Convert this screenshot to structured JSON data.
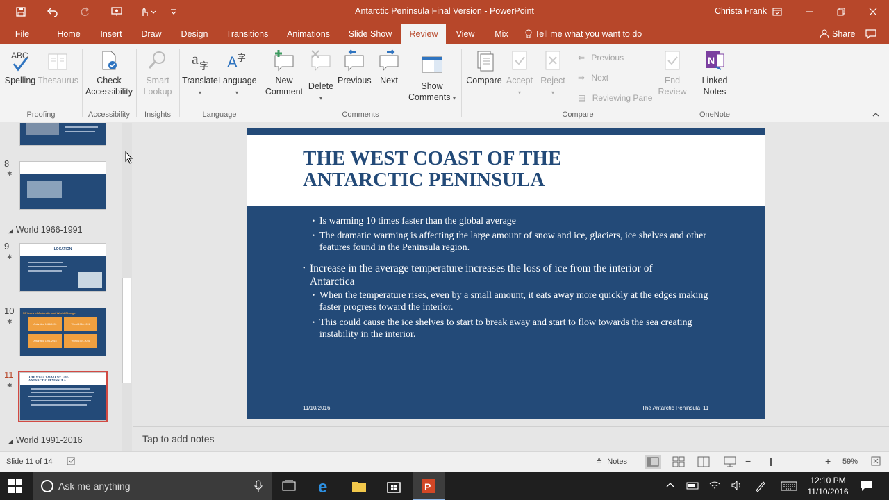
{
  "window": {
    "title": "Antarctic Peninsula Final Version  -  PowerPoint",
    "user": "Christa Frank"
  },
  "tabs": [
    "File",
    "Home",
    "Insert",
    "Draw",
    "Design",
    "Transitions",
    "Animations",
    "Slide Show",
    "Review",
    "View",
    "Mix"
  ],
  "active_tab": "Review",
  "tell_me": "Tell me what you want to do",
  "share": "Share",
  "ribbon": {
    "proofing": {
      "label": "Proofing",
      "spelling": "Spelling",
      "spelling_abc": "ABC",
      "thesaurus": "Thesaurus"
    },
    "accessibility": {
      "label": "Accessibility",
      "check": "Check",
      "check2": "Accessibility"
    },
    "insights": {
      "label": "Insights",
      "smart": "Smart",
      "smart2": "Lookup"
    },
    "language": {
      "label": "Language",
      "translate": "Translate",
      "language": "Language"
    },
    "comments": {
      "label": "Comments",
      "new": "New",
      "new2": "Comment",
      "delete": "Delete",
      "previous": "Previous",
      "next": "Next",
      "show": "Show",
      "show2": "Comments"
    },
    "compare": {
      "label": "Compare",
      "compare": "Compare",
      "accept": "Accept",
      "reject": "Reject",
      "previous": "Previous",
      "next": "Next",
      "reviewing_pane": "Reviewing Pane",
      "end": "End",
      "end2": "Review"
    },
    "onenote": {
      "label": "OneNote",
      "linked": "Linked",
      "linked2": "Notes"
    }
  },
  "thumbnails": {
    "sections": [
      "World 1966-1991",
      "World 1991-2016"
    ],
    "numbers": [
      "8",
      "9",
      "10",
      "11"
    ],
    "slide9_title": "LOCATION",
    "slide10_title": "50 Years of Antarctic and World Change",
    "slide10_cells": [
      "Antarctica 1966-1991",
      "World 1966-1991",
      "Antarctica 1991-2016",
      "World 1991-2016"
    ],
    "slide11_title": "THE WEST COAST OF THE ANTARCTIC PENINSULA"
  },
  "slide": {
    "title_line1": "THE WEST COAST OF THE",
    "title_line2": "ANTARCTIC PENINSULA",
    "bullets": [
      {
        "level": 2,
        "text": "Is warming 10 times faster than the global average"
      },
      {
        "level": 2,
        "text": "The dramatic warming is affecting the large amount of snow and ice, glaciers, ice shelves and other features found in the Peninsula region."
      },
      {
        "level": 1,
        "text": "Increase in the average temperature increases the loss of ice from the interior of Antarctica"
      },
      {
        "level": 2,
        "text": "When the temperature rises, even by a small amount, it eats away more quickly at the edges making faster progress toward the interior."
      },
      {
        "level": 2,
        "text": "This could cause the ice shelves to start to break away and start to flow towards the sea creating instability in the interior."
      }
    ],
    "date": "11/10/2016",
    "footer": "The Antarctic Peninsula",
    "number": "11"
  },
  "notes_placeholder": "Tap to add notes",
  "status": {
    "slide_info": "Slide 11 of 14",
    "notes": "Notes",
    "zoom": "59%",
    "zoom_fraction": 0.59
  },
  "taskbar": {
    "search": "Ask me anything",
    "time": "12:10 PM",
    "date": "11/10/2016"
  },
  "colors": {
    "brand": "#b7472a",
    "slide_blue": "#234a78",
    "orange": "#f0a040"
  }
}
